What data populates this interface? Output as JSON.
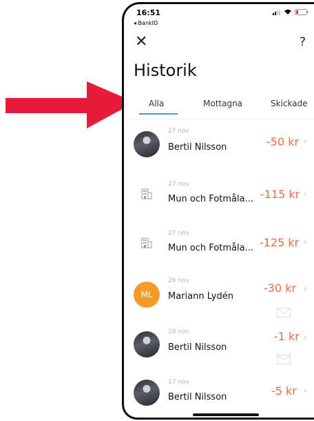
{
  "status": {
    "time": "16:51",
    "back_app": "◂ BankID"
  },
  "header": {
    "close_icon": "✕",
    "help_label": "?",
    "title": "Historik"
  },
  "tabs": [
    {
      "label": "Alla",
      "active": true
    },
    {
      "label": "Mottagna",
      "active": false
    },
    {
      "label": "Skickade",
      "active": false
    }
  ],
  "transactions": [
    {
      "date": "27 nov",
      "name": "Bertil Nilsson",
      "amount": "-50 kr",
      "avatar": "photo"
    },
    {
      "date": "27 nov",
      "name": "Mun och Fotmåla...",
      "amount": "-115 kr",
      "avatar": "building-icon"
    },
    {
      "date": "27 nov",
      "name": "Mun och Fotmåla...",
      "amount": "-125 kr",
      "avatar": "building-icon"
    },
    {
      "date": "26 nov",
      "name": "Mariann Lydén",
      "amount": "-30 kr",
      "avatar": "initials",
      "initials": "ML",
      "has_message": true
    },
    {
      "date": "19 nov",
      "name": "Bertil Nilsson",
      "amount": "-1 kr",
      "avatar": "photo",
      "has_message": true
    },
    {
      "date": "17 nov",
      "name": "Bertil Nilsson",
      "amount": "-5 kr",
      "avatar": "photo"
    }
  ],
  "chevron": "›",
  "colors": {
    "amount": "#ef6a45",
    "tab_underline": "#3aa0d8",
    "initials_avatar": "#f59b2b",
    "arrow": "#e81c3a"
  }
}
